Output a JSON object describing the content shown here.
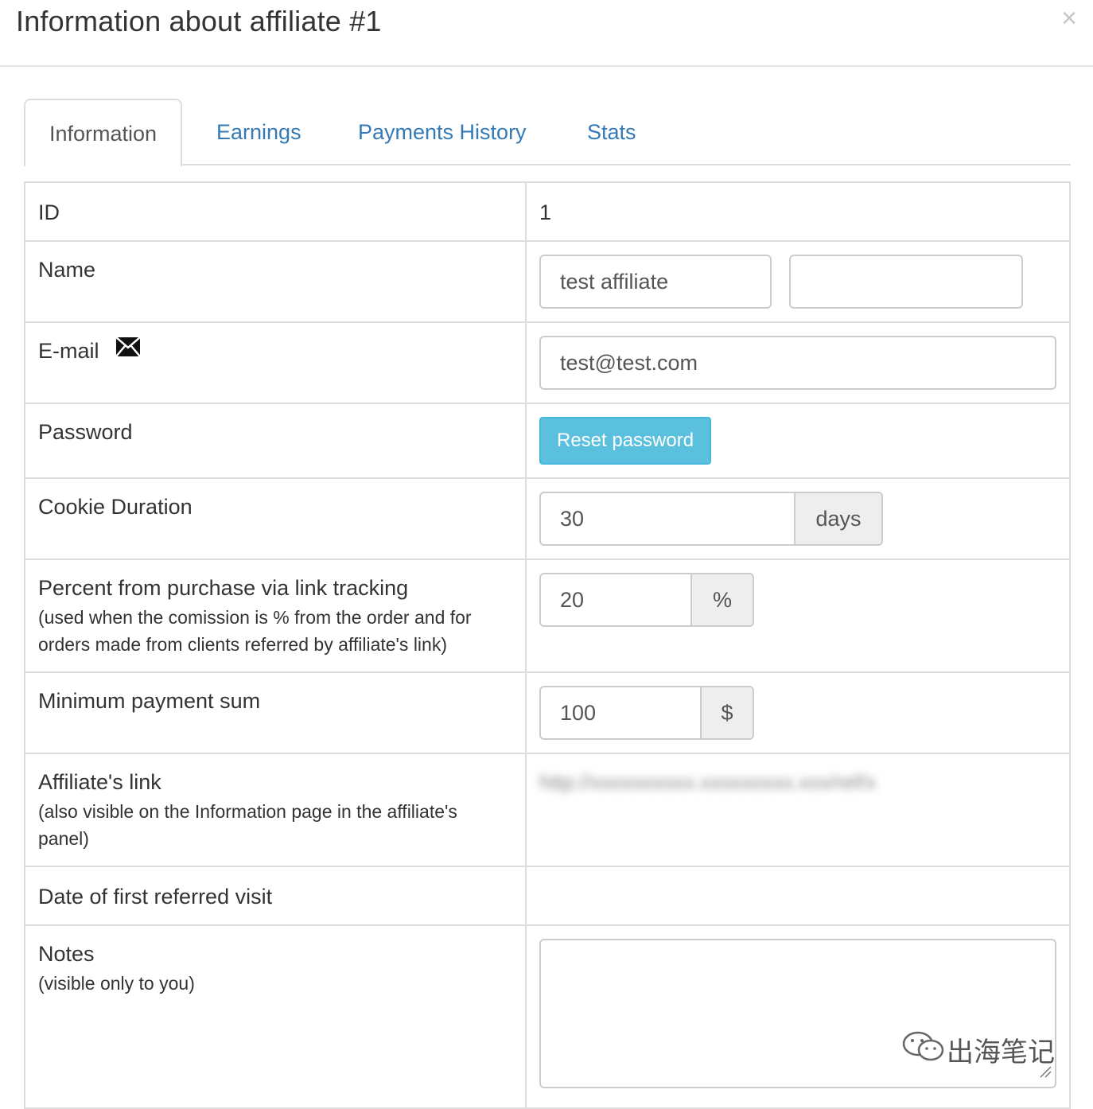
{
  "modal": {
    "title": "Information about affiliate #1",
    "close_label": "×"
  },
  "tabs": [
    {
      "label": "Information",
      "active": true
    },
    {
      "label": "Earnings",
      "active": false
    },
    {
      "label": "Payments History",
      "active": false
    },
    {
      "label": "Stats",
      "active": false
    }
  ],
  "rows": {
    "id": {
      "label": "ID",
      "value": "1"
    },
    "name": {
      "label": "Name",
      "first_value": "test affiliate",
      "second_value": ""
    },
    "email": {
      "label": "E-mail",
      "value": "test@test.com",
      "icon": "envelope-icon"
    },
    "password": {
      "label": "Password",
      "button_label": "Reset password"
    },
    "cookie": {
      "label": "Cookie Duration",
      "value": "30",
      "unit": "days"
    },
    "percent": {
      "label": "Percent from purchase via link tracking",
      "hint": "(used when the comission is % from the order and for orders made from clients referred by affiliate's link)",
      "value": "20",
      "unit": "%"
    },
    "min_payment": {
      "label": "Minimum payment sum",
      "value": "100",
      "unit": "$"
    },
    "link": {
      "label": "Affiliate's link",
      "hint": "(also visible on the Information page in the affiliate's panel)",
      "value": "http://xxxxxxxxxx.xxxxxxxxx.xxx/ref/x"
    },
    "first_visit": {
      "label": "Date of first referred visit",
      "value": ""
    },
    "notes": {
      "label": "Notes",
      "hint": "(visible only to you)",
      "value": ""
    }
  },
  "watermark": {
    "text": "出海笔记"
  },
  "colors": {
    "link": "#337ab7",
    "button_info": "#5bc0de",
    "border": "#dddddd"
  }
}
